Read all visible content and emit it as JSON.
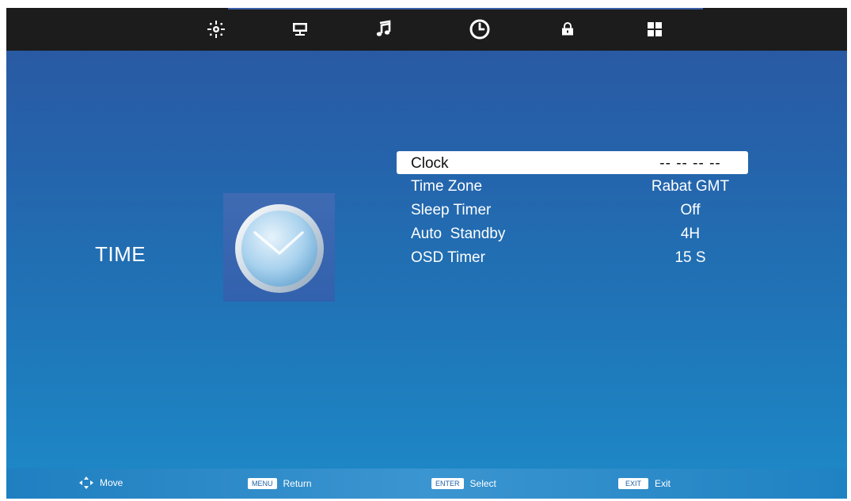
{
  "top_nav": {
    "items": [
      {
        "icon": "picture-settings-icon"
      },
      {
        "icon": "monitor-icon"
      },
      {
        "icon": "music-note-icon"
      },
      {
        "icon": "clock-icon"
      },
      {
        "icon": "lock-icon"
      },
      {
        "icon": "grid-icon"
      }
    ],
    "active_index": 3
  },
  "section": {
    "title": "TIME",
    "image_icon": "analog-clock-icon"
  },
  "menu": {
    "items": [
      {
        "label": "Clock",
        "value": "-- -- -- --",
        "selected": true
      },
      {
        "label": "Time Zone",
        "value": "Rabat GMT"
      },
      {
        "label": "Sleep Timer",
        "value": "Off"
      },
      {
        "label": "Auto  Standby",
        "value": "4H"
      },
      {
        "label": "OSD Timer",
        "value": "15 S"
      }
    ]
  },
  "footer": {
    "move": {
      "icon": "dpad-arrows-icon",
      "label": "Move"
    },
    "return": {
      "key": "MENU",
      "label": "Return"
    },
    "select": {
      "key": "ENTER",
      "label": "Select"
    },
    "exit": {
      "key": "EXIT",
      "label": "Exit"
    }
  },
  "colors": {
    "background_top": "#2a57a0",
    "background_bottom": "#1d8ac8",
    "topbar": "#1c1c1c",
    "selection": "#ffffff"
  }
}
